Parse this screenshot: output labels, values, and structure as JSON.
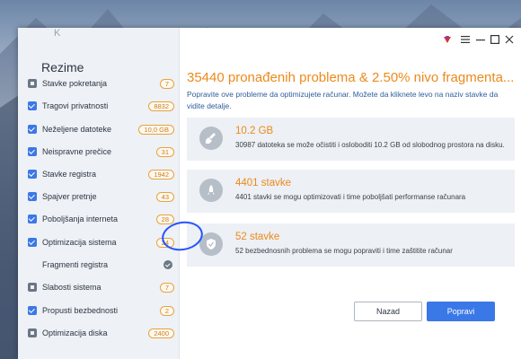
{
  "sidebar": {
    "logo_text": "K",
    "title": "Rezime",
    "items": [
      {
        "label": "Stavke pokretanja",
        "badge": "7",
        "state": "square"
      },
      {
        "label": "Tragovi privatnosti",
        "badge": "8832",
        "state": "checked"
      },
      {
        "label": "Neželjene datoteke",
        "badge": "10,0 GB",
        "state": "checked"
      },
      {
        "label": "Neispravne prečice",
        "badge": "31",
        "state": "checked"
      },
      {
        "label": "Stavke registra",
        "badge": "1942",
        "state": "checked"
      },
      {
        "label": "Spajver pretnje",
        "badge": "43",
        "state": "checked"
      },
      {
        "label": "Poboljšanja interneta",
        "badge": "28",
        "state": "checked"
      },
      {
        "label": "Optimizacija sistema",
        "badge": "24",
        "state": "checked"
      },
      {
        "label": "Fragmenti registra",
        "badge": "",
        "state": "none"
      },
      {
        "label": "Slabosti sistema",
        "badge": "7",
        "state": "square"
      },
      {
        "label": "Propusti bezbednosti",
        "badge": "2",
        "state": "checked"
      },
      {
        "label": "Optimizacija diska",
        "badge": "2400",
        "state": "square"
      }
    ]
  },
  "main": {
    "title": "35440 pronađenih problema & 2.50%  nivo fragmenta...",
    "description": "Popravite ove probleme da optimizujete računar. Možete da kliknete levo  na naziv stavke da vidite detalje.",
    "cards": [
      {
        "title": "10.2 GB",
        "desc": "30987 datoteka se može očistiti i osloboditi  10.2 GB  od slobodnog prostora na disku.",
        "icon": "broom-icon"
      },
      {
        "title": "4401 stavke",
        "desc": "4401 stavki  se mogu optimizovati i time poboljšati performanse računara",
        "icon": "rocket-icon"
      },
      {
        "title": "52 stavke",
        "desc": "52 bezbednosnih problema se mogu popraviti i time zaštitite računar",
        "icon": "shield-icon"
      }
    ]
  },
  "buttons": {
    "back": "Nazad",
    "fix": "Popravi"
  },
  "colors": {
    "accent": "#3b78e7",
    "orange": "#ec8a1c",
    "link_blue": "#2e5e9a",
    "circle_mark": "#2454ff"
  }
}
